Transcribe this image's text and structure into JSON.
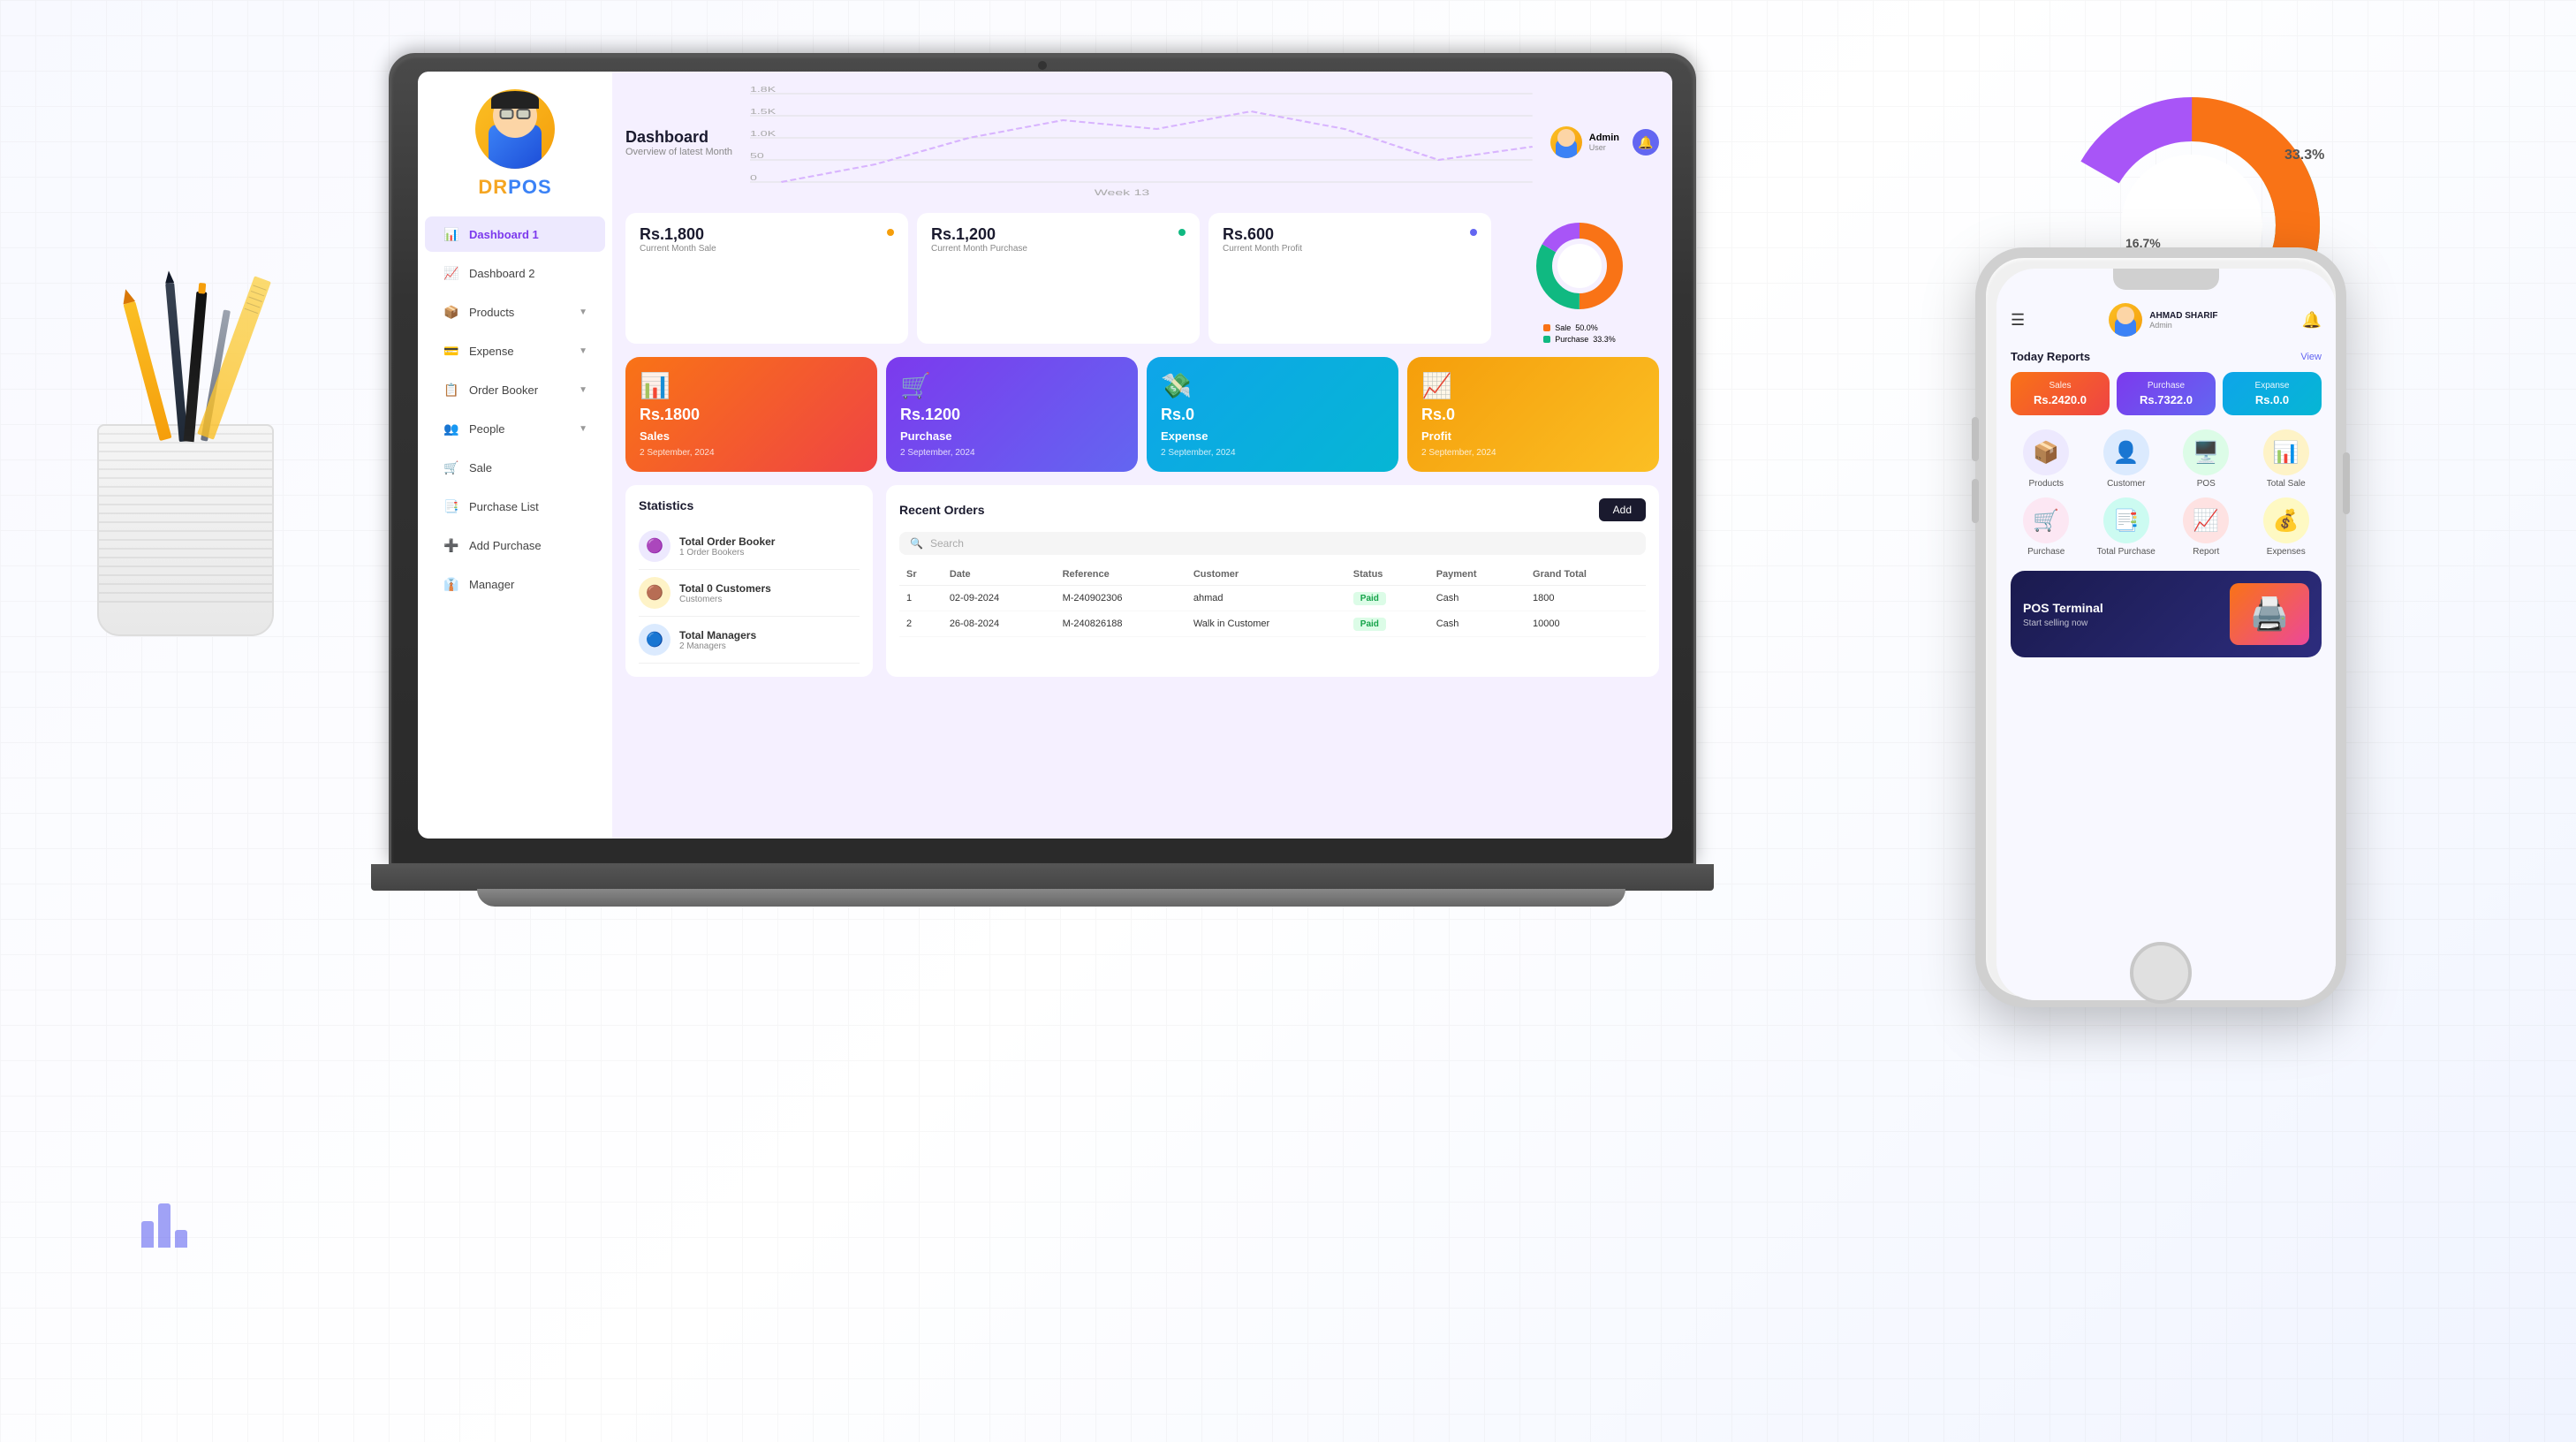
{
  "app": {
    "name": "DRPOS",
    "logo_dr": "DR",
    "logo_pos": "POS"
  },
  "sidebar": {
    "items": [
      {
        "id": "dashboard1",
        "label": "Dashboard 1",
        "icon": "📊",
        "active": true
      },
      {
        "id": "dashboard2",
        "label": "Dashboard 2",
        "icon": "📈"
      },
      {
        "id": "products",
        "label": "Products",
        "icon": "📦",
        "has_arrow": true
      },
      {
        "id": "expense",
        "label": "Expense",
        "icon": "💳",
        "has_arrow": true
      },
      {
        "id": "order-booker",
        "label": "Order Booker",
        "icon": "📋",
        "has_arrow": true
      },
      {
        "id": "people",
        "label": "People",
        "icon": "👥",
        "has_arrow": true
      },
      {
        "id": "sale",
        "label": "Sale",
        "icon": "🛒"
      },
      {
        "id": "purchase-list",
        "label": "Purchase List",
        "icon": "📑"
      },
      {
        "id": "add-purchase",
        "label": "Add Purchase",
        "icon": "➕"
      },
      {
        "id": "manager",
        "label": "Manager",
        "icon": "👔"
      }
    ]
  },
  "header": {
    "title": "Dashboard",
    "subtitle": "Overview of latest Month",
    "user": {
      "name": "Admin",
      "role": "User"
    }
  },
  "stats": [
    {
      "value": "Rs.1,800",
      "label": "Current Month Sale",
      "dot_color": "#f59e0b"
    },
    {
      "value": "Rs.1,200",
      "label": "Current Month Purchase",
      "dot_color": "#10b981"
    },
    {
      "value": "Rs.600",
      "label": "Current Month Profit",
      "dot_color": "#6366f1"
    }
  ],
  "summary_cards": [
    {
      "id": "sales",
      "value": "Rs.1800",
      "label": "Sales",
      "date": "2 September, 2024",
      "icon": "📊",
      "class": "sales"
    },
    {
      "id": "purchase",
      "value": "Rs.1200",
      "label": "Purchase",
      "date": "2 September, 2024",
      "icon": "🛒",
      "class": "purchase"
    },
    {
      "id": "expense",
      "value": "Rs.0",
      "label": "Expense",
      "date": "2 September, 2024",
      "icon": "💸",
      "class": "expense"
    },
    {
      "id": "profit",
      "value": "Rs.0",
      "label": "Profit",
      "date": "2 September, 2024",
      "icon": "📈",
      "class": "profit"
    }
  ],
  "statistics": {
    "title": "Statistics",
    "items": [
      {
        "id": "order-booker",
        "label": "Total Order Booker",
        "sublabel": "1 Order Bookers",
        "icon": "🟣",
        "bg": "#ede9fe"
      },
      {
        "id": "customers",
        "label": "Total 0 Customers",
        "sublabel": "Customers",
        "icon": "🟤",
        "bg": "#fef3c7"
      },
      {
        "id": "managers",
        "label": "Total Managers",
        "sublabel": "2 Managers",
        "icon": "🔵",
        "bg": "#dbeafe"
      }
    ]
  },
  "recent_orders": {
    "title": "Recent Orders",
    "add_button": "Add",
    "search_placeholder": "Search",
    "columns": [
      "Sr",
      "Date",
      "Reference",
      "Customer",
      "Status",
      "Payment",
      "Grand Total"
    ],
    "rows": [
      {
        "sr": "1",
        "date": "02-09-2024",
        "reference": "M-240902306",
        "customer": "ahmad",
        "status": "Paid",
        "payment": "Cash",
        "total": "1800"
      },
      {
        "sr": "2",
        "date": "26-08-2024",
        "reference": "M-240826188",
        "customer": "Walk in Customer",
        "status": "Paid",
        "payment": "Cash",
        "total": "10000"
      }
    ]
  },
  "donut_chart": {
    "segments": [
      {
        "label": "Sale",
        "percent": 50.0,
        "color": "#f97316"
      },
      {
        "label": "Purchase",
        "percent": 33.3,
        "color": "#10b981"
      },
      {
        "label": "Profit",
        "percent": 16.7,
        "color": "#a855f7"
      }
    ],
    "legend": [
      {
        "label": "Sale",
        "value": "50.0%",
        "color": "#f97316"
      },
      {
        "label": "Purchase",
        "value": "33.3%",
        "color": "#10b981"
      }
    ]
  },
  "phone": {
    "user": {
      "name": "AHMAD SHARIF",
      "role": "Admin"
    },
    "today_reports": {
      "title": "Today Reports",
      "view_label": "View",
      "cards": [
        {
          "label": "Sales",
          "value": "Rs.2420.0",
          "class": "sales-card"
        },
        {
          "label": "Purchase",
          "value": "Rs.7322.0",
          "class": "purchase-card"
        },
        {
          "label": "Expanse",
          "value": "Rs.0.0",
          "class": "expense-card"
        }
      ]
    },
    "icons": [
      {
        "id": "products",
        "label": "Products",
        "icon": "📦",
        "bg": "purple"
      },
      {
        "id": "customer",
        "label": "Customer",
        "icon": "👤",
        "bg": "blue"
      },
      {
        "id": "pos",
        "label": "POS",
        "icon": "🖥️",
        "bg": "green"
      },
      {
        "id": "total-sale",
        "label": "Total Sale",
        "icon": "📊",
        "bg": "orange"
      },
      {
        "id": "purchase",
        "label": "Purchase",
        "icon": "🛒",
        "bg": "pink"
      },
      {
        "id": "total-purchase",
        "label": "Total Purchase",
        "icon": "📑",
        "bg": "teal"
      },
      {
        "id": "report",
        "label": "Report",
        "icon": "📈",
        "bg": "red"
      },
      {
        "id": "expenses",
        "label": "Expenses",
        "icon": "💰",
        "bg": "yellow"
      }
    ],
    "pos_terminal": {
      "title": "POS Terminal",
      "subtitle": "Start selling now"
    }
  },
  "line_chart": {
    "weeks": [
      "Week 13"
    ],
    "y_labels": [
      "1,8K",
      "1,5K",
      "1,0K",
      "50",
      "0"
    ]
  }
}
